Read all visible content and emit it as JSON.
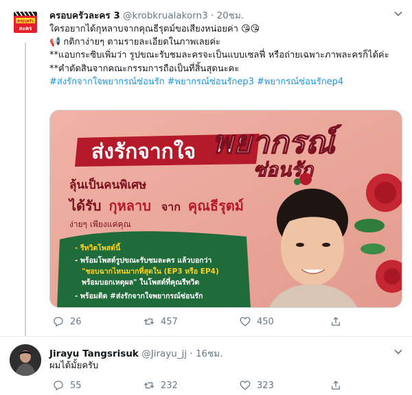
{
  "tweets": [
    {
      "name": "ครอบครัวละคร 3",
      "handle": "@krobkrualakorn3",
      "time": "20ชม.",
      "avatar_text": [
        "ครอบครัว",
        "ละคร"
      ],
      "lines": [
        "ใครอยากได้กุหลาบจากคุณธีรุตม์ขอเสียงหน่อยค่า 😘😘",
        "📢 กติกาง่ายๆ ตามรายละเอียดในภาพเลยค่ะ",
        "**แอบกระซิบเพิ่มว่า รูปขณะรับชมละครจะเป็นแบบเซลฟี่ หรือถ่ายเฉพาะภาพละครก็ได้ค่ะ",
        "**คำตัดสินจากคณะกรรมการถือเป็นที่สิ้นสุดนะคะ"
      ],
      "hashtags": "#ส่งรักจากใจพยากรณ์ซ่อนรัก #พยากรณ์ซ่อนรักep3 #พยากรณ์ซ่อนรักep4",
      "media": {
        "headline_left": "ส่งรักจากใจ",
        "headline_right": "พยากรณ์",
        "headline_sub": "ซ่อนรัก",
        "line1": "ลุ้นเป็นคนพิเศษ",
        "line2a": "ได้รับ",
        "line2b": "กุหลาบ",
        "line2c": "จาก",
        "line2d": "คุณธีรุตม์",
        "line3": "ง่ายๆ เพียงแค่คุณ",
        "bullets": [
          "- รีทวิตโพสต์นี้",
          "- พร้อมโพสต์รูปขณะรับชมละคร แล้วบอกว่า",
          "\"ชอบฉากไหนมากที่สุดใน (EP3 หรือ EP4)",
          "พร้อมบอกเหตุผล\" ในโพสต์ที่คุณรีทวิต",
          "- พร้อมติด #ส่งรักจากใจพยากรณ์ซ่อนรัก"
        ]
      },
      "actions": {
        "replies": "26",
        "retweets": "457",
        "likes": "450"
      }
    },
    {
      "name": "Jirayu Tangsrisuk",
      "handle": "@Jirayu_jj",
      "time": "16ชม.",
      "text": "ผมได้มั้ยครับ",
      "actions": {
        "replies": "55",
        "retweets": "232",
        "likes": "323"
      }
    }
  ],
  "colors": {
    "accent": "#1b95e0",
    "muted": "#657786",
    "media_bg": "#e8a79b",
    "banner_red": "#b51a2a",
    "panel_green": "#1f6b3a",
    "yellow": "#ffd21f"
  }
}
